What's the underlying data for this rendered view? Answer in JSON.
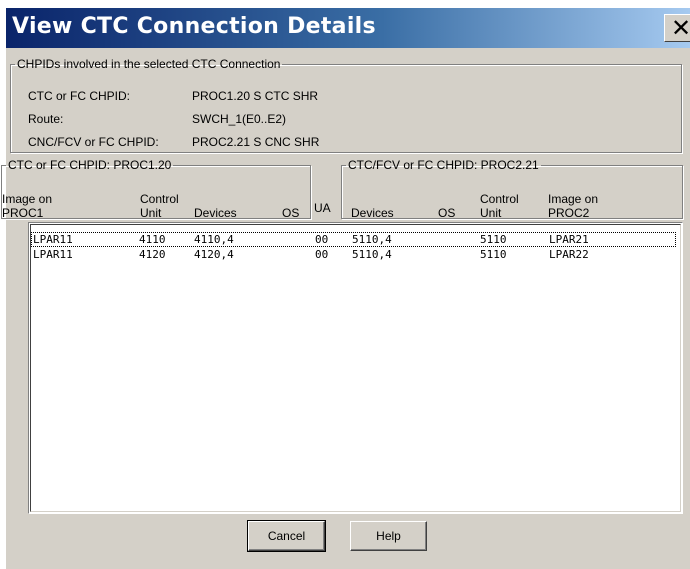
{
  "window": {
    "title": "View CTC Connection Details"
  },
  "chpid_group": {
    "legend": "CHPIDs involved in the selected CTC Connection",
    "rows": [
      {
        "label": "CTC or FC CHPID:",
        "value": "PROC1.20 S CTC SHR"
      },
      {
        "label": "Route:",
        "value": "SWCH_1(E0..E2)"
      },
      {
        "label": "CNC/FCV or FC CHPID:",
        "value": "PROC2.21 S CNC SHR"
      }
    ]
  },
  "left_group": {
    "legend": "CTC or FC CHPID: PROC1.20",
    "headers": {
      "image": [
        "Image on",
        "PROC1"
      ],
      "control_unit": [
        "Control",
        "Unit"
      ],
      "devices": "Devices",
      "os": "OS"
    }
  },
  "middle_header": {
    "ua": "UA"
  },
  "right_group": {
    "legend": "CTC/FCV or FC CHPID: PROC2.21",
    "headers": {
      "devices": "Devices",
      "os": "OS",
      "control_unit": [
        "Control",
        "Unit"
      ],
      "image": [
        "Image on",
        "PROC2"
      ]
    }
  },
  "table": {
    "rows": [
      {
        "image1": "LPAR11",
        "cu1": "4110",
        "devices1": "4110,4",
        "os1": "",
        "ua": "00",
        "devices2": "5110,4",
        "os2": "",
        "cu2": "5110",
        "image2": "LPAR21",
        "selected": true
      },
      {
        "image1": "LPAR11",
        "cu1": "4120",
        "devices1": "4120,4",
        "os1": "",
        "ua": "00",
        "devices2": "5110,4",
        "os2": "",
        "cu2": "5110",
        "image2": "LPAR22",
        "selected": false
      }
    ]
  },
  "buttons": {
    "cancel": "Cancel",
    "help": "Help"
  },
  "colors": {
    "title_start": "#0a246a",
    "title_end": "#a6caf0",
    "dialog_face": "#d4d0c8"
  }
}
